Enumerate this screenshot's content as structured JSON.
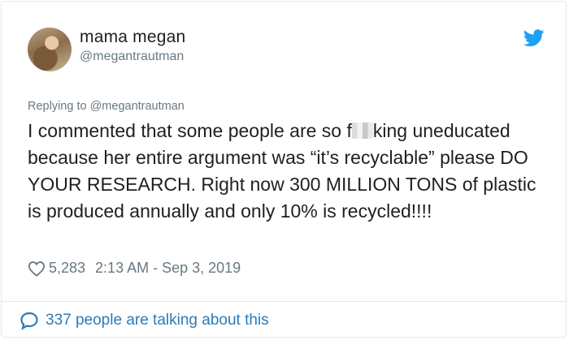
{
  "author": {
    "display_name": "mama megan",
    "handle": "@megantrautman"
  },
  "reply": {
    "prefix": "Replying to",
    "handle": "@megantrautman"
  },
  "tweet": {
    "text_part1": "I commented that some people are so f",
    "text_part2": "king uneducated because her entire argument was “it’s recyclable” please DO YOUR RESEARCH. Right now 300 MILLION TONS of plastic is produced annually and only 10% is recycled!!!!"
  },
  "meta": {
    "likes": "5,283",
    "timestamp": "2:13 AM - Sep 3, 2019"
  },
  "footer": {
    "talking": "337 people are talking about this"
  },
  "icons": [
    "twitter-bird-icon",
    "heart-icon",
    "speech-bubble-icon"
  ],
  "colors": {
    "twitter_blue": "#1da1f2",
    "link_blue": "#2b7bb9",
    "muted": "#697882",
    "text": "#1c2022"
  }
}
